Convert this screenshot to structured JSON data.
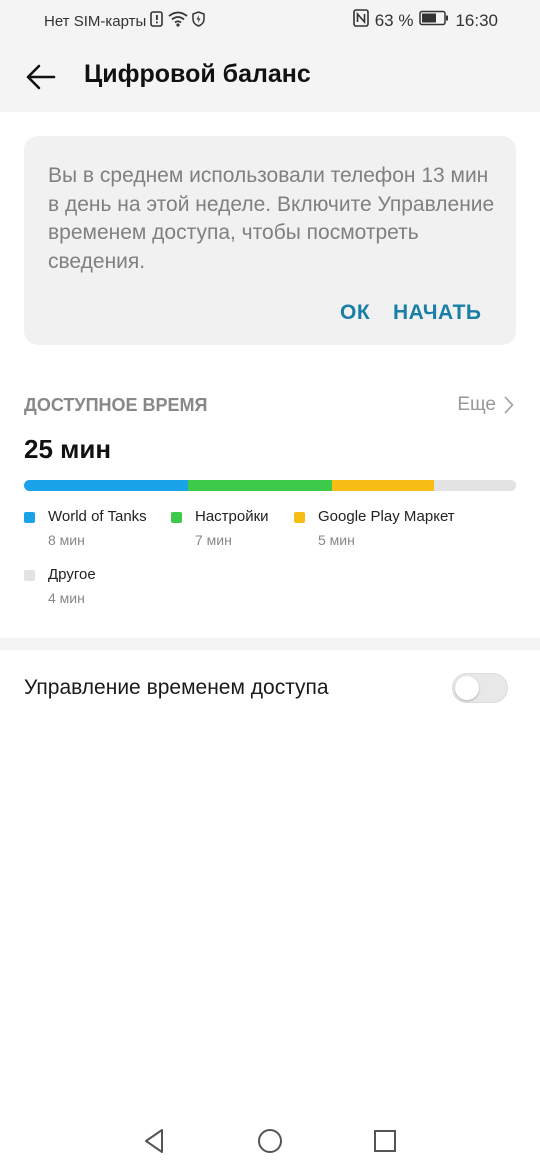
{
  "status": {
    "sim": "Нет SIM-карты",
    "battery": "63 %",
    "time": "16:30"
  },
  "header": {
    "title": "Цифровой баланс"
  },
  "card": {
    "text": "Вы в среднем использовали телефон 13 мин в день на этой неделе. Включите Управление временем доступа, чтобы посмотреть сведения.",
    "ok_label": "ОК",
    "start_label": "НАЧАТЬ"
  },
  "usage": {
    "section_title": "ДОСТУПНОЕ ВРЕМЯ",
    "more_label": "Еще",
    "total": "25 мин",
    "apps": [
      {
        "name": "World of Tanks",
        "time": "8 мин",
        "minutes": 8,
        "color": "#1aa3e8"
      },
      {
        "name": "Настройки",
        "time": "7 мин",
        "minutes": 7,
        "color": "#3dc94a"
      },
      {
        "name": "Google Play Маркет",
        "time": "5 мин",
        "minutes": 5,
        "color": "#f7bd14"
      },
      {
        "name": "Другое",
        "time": "4 мин",
        "minutes": 4,
        "color": "#e3e3e3"
      }
    ]
  },
  "settings": {
    "access_control_label": "Управление временем доступа",
    "access_control_enabled": false
  },
  "colors": {
    "accent": "#1a7fa6"
  }
}
